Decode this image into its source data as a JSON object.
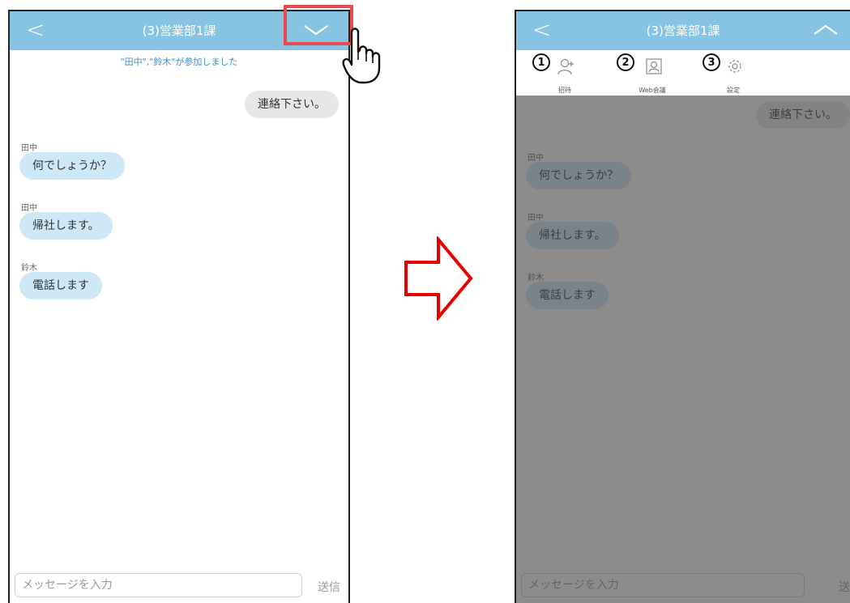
{
  "left_screen": {
    "header": {
      "back": "<",
      "title": "(3)営業部1課"
    },
    "join_notice": "\"田中\",\"鈴木\"が参加しました",
    "messages": [
      {
        "sender": "",
        "text": "連絡下さい。",
        "direction": "out"
      },
      {
        "sender": "田中",
        "text": "何でしょうか？",
        "direction": "in"
      },
      {
        "sender": "田中",
        "text": "帰社します。",
        "direction": "in"
      },
      {
        "sender": "鈴木",
        "text": "電話します",
        "direction": "in"
      }
    ],
    "composer": {
      "placeholder": "メッセージを入力",
      "send": "送信"
    }
  },
  "right_screen": {
    "header": {
      "back": "<",
      "title": "(3)営業部1課"
    },
    "menu": [
      {
        "number": "1",
        "label": "招待",
        "icon": "invite-user-icon"
      },
      {
        "number": "2",
        "label": "Web会議",
        "icon": "web-meeting-icon"
      },
      {
        "number": "3",
        "label": "設定",
        "icon": "settings-gear-icon"
      }
    ],
    "messages": [
      {
        "sender": "",
        "text": "連絡下さい。",
        "direction": "out"
      },
      {
        "sender": "田中",
        "text": "何でしょうか？",
        "direction": "in"
      },
      {
        "sender": "田中",
        "text": "帰社します。",
        "direction": "in"
      },
      {
        "sender": "鈴木",
        "text": "電話します",
        "direction": "in"
      }
    ],
    "composer": {
      "placeholder": "メッセージを入力",
      "send": "送信"
    }
  },
  "colors": {
    "header": "#87c4e4",
    "incoming_bubble": "#cfe8f6",
    "outgoing_bubble": "#e7e7ea",
    "highlight": "#e94b4b",
    "arrow": "#e60000"
  }
}
